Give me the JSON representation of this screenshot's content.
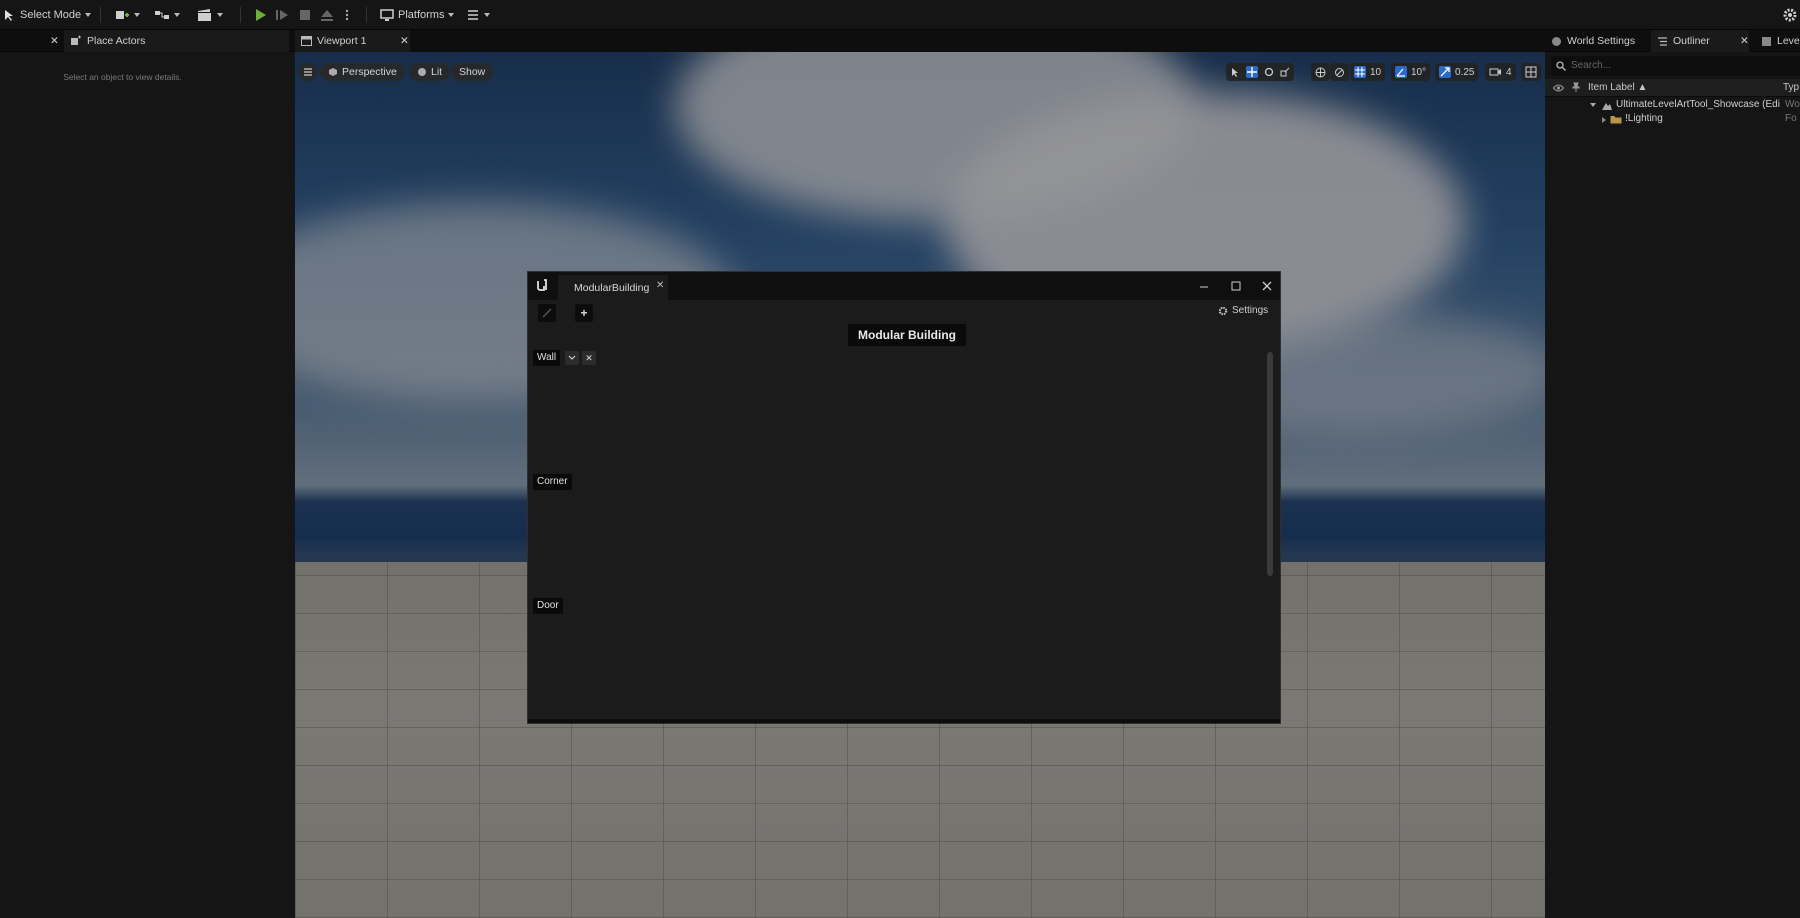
{
  "toolbar": {
    "select_mode_label": "Select Mode",
    "platforms_label": "Platforms",
    "icons": [
      "select-mode-icon",
      "add-actor-icon",
      "blueprint-icon",
      "cinematics-icon",
      "play-icon",
      "advance-frame-icon",
      "stop-icon",
      "eject-icon",
      "more-options-icon",
      "platforms-icon",
      "menu-icon",
      "settings-icon"
    ]
  },
  "left_panel": {
    "tab_label": "Place Actors",
    "details_hint": "Select an object to view details."
  },
  "viewport": {
    "tab_label": "Viewport 1",
    "view_mode": "Perspective",
    "lighting": "Lit",
    "show_label": "Show",
    "grid_snap": "10",
    "rotation_snap": "10°",
    "scale_snap": "0.25",
    "camera_speed": "4"
  },
  "dialog": {
    "tab_label": "ModularBuilding",
    "settings_label": "Settings",
    "heading": "Modular Building",
    "categories": [
      "Wall",
      "Corner",
      "Door"
    ]
  },
  "right_panel": {
    "tabs": [
      "World Settings",
      "Outliner",
      "Level"
    ],
    "search_placeholder": "Search...",
    "column_label": "Item Label ▲",
    "type_column": "Typ",
    "rows": [
      {
        "label": "UltimateLevelArtTool_Showcase (Editc",
        "type": "Wo"
      },
      {
        "label": "!Lighting",
        "type": "Fo"
      }
    ]
  },
  "colors": {
    "accent_green": "#6fae3a",
    "selected_blue": "#2a6ac9"
  }
}
